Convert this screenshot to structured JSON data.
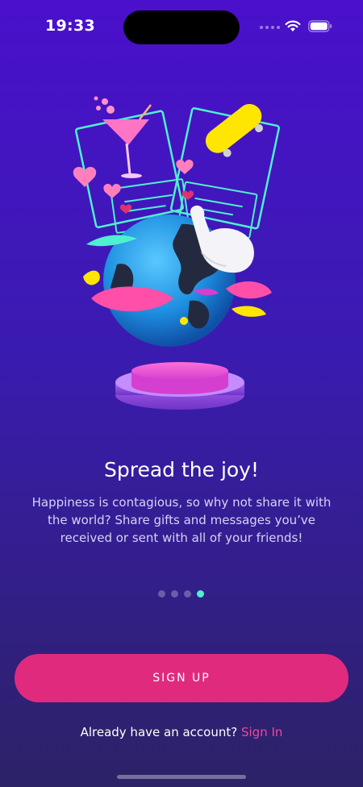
{
  "status_bar": {
    "time": "19:33",
    "wifi_icon": "wifi-icon",
    "battery_icon": "battery-icon"
  },
  "onboarding": {
    "title": "Spread the joy!",
    "description": "Happiness is contagious, so why not share it with the world? Share gifts and messages you’ve received or sent with all of your friends!",
    "page_indicator": {
      "total_pages": 4,
      "current_page": 4
    }
  },
  "actions": {
    "signup_label": "SIGN UP",
    "signin_prompt": "Already have an account?",
    "signin_link": "Sign In"
  },
  "colors": {
    "background_top": "#4a10cc",
    "background_bottom": "#2c2266",
    "accent_pink": "#e02a7e",
    "link_pink": "#f0479c",
    "active_dot": "#4ff0d0"
  }
}
